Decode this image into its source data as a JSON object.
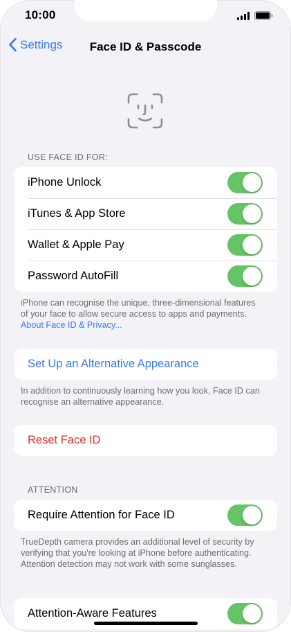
{
  "status_bar": {
    "time": "10:00"
  },
  "nav": {
    "back_label": "Settings",
    "title": "Face ID & Passcode"
  },
  "use_face_id": {
    "header": "USE FACE ID FOR:",
    "items": [
      {
        "label": "iPhone Unlock",
        "on": true
      },
      {
        "label": "iTunes & App Store",
        "on": true
      },
      {
        "label": "Wallet & Apple Pay",
        "on": true
      },
      {
        "label": "Password AutoFill",
        "on": true
      }
    ],
    "footer_text": "iPhone can recognise the unique, three-dimensional features of your face to allow secure access to apps and payments. ",
    "footer_link": "About Face ID & Privacy..."
  },
  "alternative": {
    "label": "Set Up an Alternative Appearance",
    "footer": "In addition to continuously learning how you look, Face ID can recognise an alternative appearance."
  },
  "reset": {
    "label": "Reset Face ID"
  },
  "attention": {
    "header": "ATTENTION",
    "require_label": "Require Attention for Face ID",
    "require_on": true,
    "footer": "TrueDepth camera provides an additional level of security by verifying that you're looking at iPhone before authenticating. Attention detection may not work with some sunglasses.",
    "aware_label": "Attention-Aware Features",
    "aware_on": true
  },
  "colors": {
    "accent": "#3478f6",
    "toggle_on": "#65c466",
    "destructive": "#e5312a"
  }
}
